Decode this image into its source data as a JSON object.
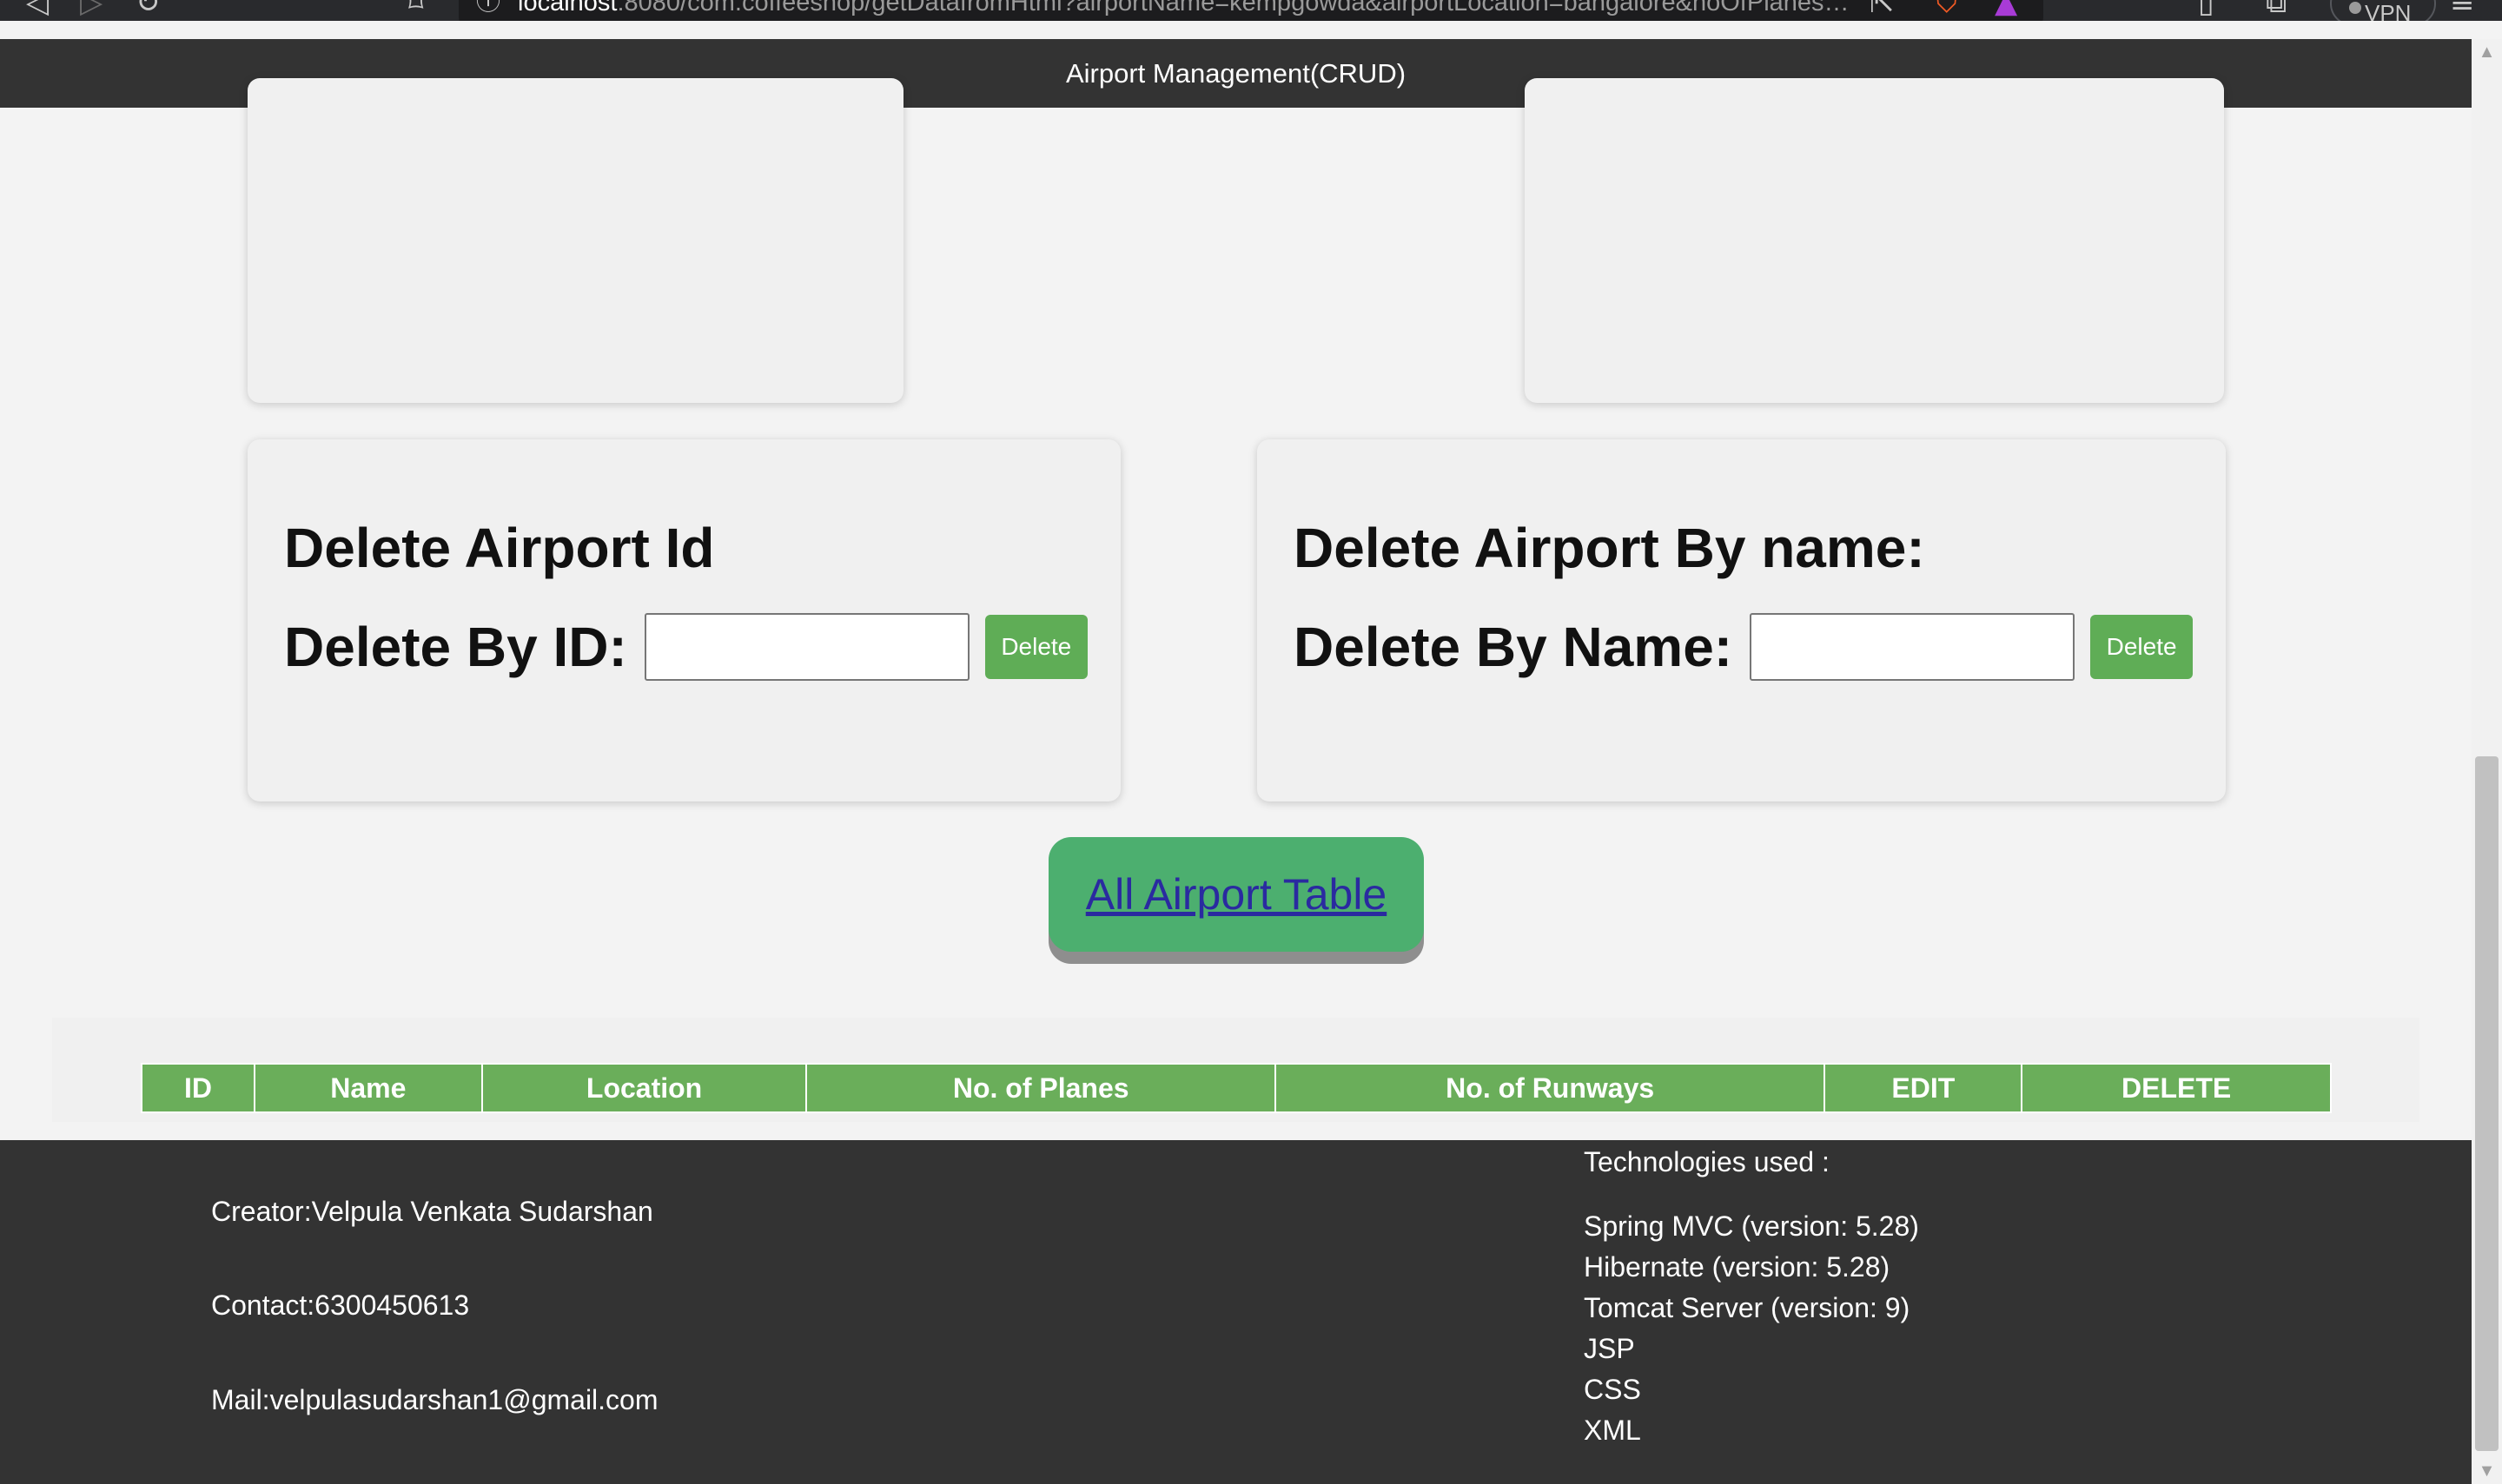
{
  "browser": {
    "url_host": "localhost",
    "url_rest": ":8080/com.coffeeshop/getDatafromHtml?airportName=kempgowda&airportLocation=bangalore&noOfPlanes=1...",
    "vpn_label": "VPN"
  },
  "header": {
    "title": "Airport Management(CRUD)"
  },
  "delete_by_id": {
    "title": "Delete Airport Id",
    "label": "Delete By ID:",
    "input_value": "",
    "button_label": "Delete"
  },
  "delete_by_name": {
    "title": "Delete Airport By name:",
    "label": "Delete By Name:",
    "input_value": "",
    "button_label": "Delete"
  },
  "all_table_link": "All Airport Table",
  "table": {
    "columns": [
      "ID",
      "Name",
      "Location",
      "No. of Planes",
      "No. of Runways",
      "EDIT",
      "DELETE"
    ]
  },
  "footer": {
    "creator": "Creator:Velpula Venkata Sudarshan",
    "contact": "Contact:6300450613",
    "mail": "Mail:velpulasudarshan1@gmail.com",
    "tech_heading": "Technologies used :",
    "technologies": [
      "Spring MVC (version: 5.28)",
      "Hibernate (version: 5.28)",
      "Tomcat Server (version: 9)",
      "JSP",
      "CSS",
      "XML"
    ]
  },
  "colors": {
    "header_bg": "#333333",
    "accent_green": "#5fad56",
    "table_header_green": "#6aae5a",
    "link_button_green": "#4caf6f"
  },
  "icons": [
    "back-icon",
    "forward-icon",
    "reload-icon",
    "bookmark-icon",
    "info-icon",
    "share-icon",
    "brave-shield-icon",
    "rewards-icon",
    "sidebar-icon",
    "wallet-icon",
    "menu-icon"
  ]
}
